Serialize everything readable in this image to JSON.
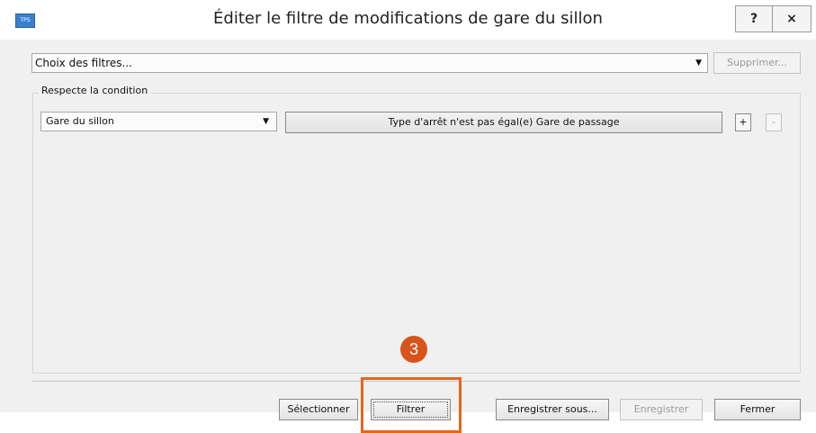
{
  "window": {
    "title": "Éditer le filtre de modifications de gare du sillon",
    "app_icon_text": "TPS",
    "help_label": "?",
    "close_label": "×"
  },
  "filters": {
    "select_value": "Choix des filtres...",
    "delete_label": "Supprimer..."
  },
  "condition_group": {
    "label": "Respecte la condition",
    "field_value": "Gare du sillon",
    "condition_label": "Type d'arrêt n'est pas égal(e) Gare de passage",
    "add_label": "+",
    "remove_label": "-"
  },
  "footer": {
    "select_label": "Sélectionner",
    "filter_label": "Filtrer",
    "save_as_label": "Enregistrer sous...",
    "save_label": "Enregistrer",
    "close_label": "Fermer"
  },
  "annotation": {
    "step_number": "3",
    "color": "#e4661d"
  }
}
